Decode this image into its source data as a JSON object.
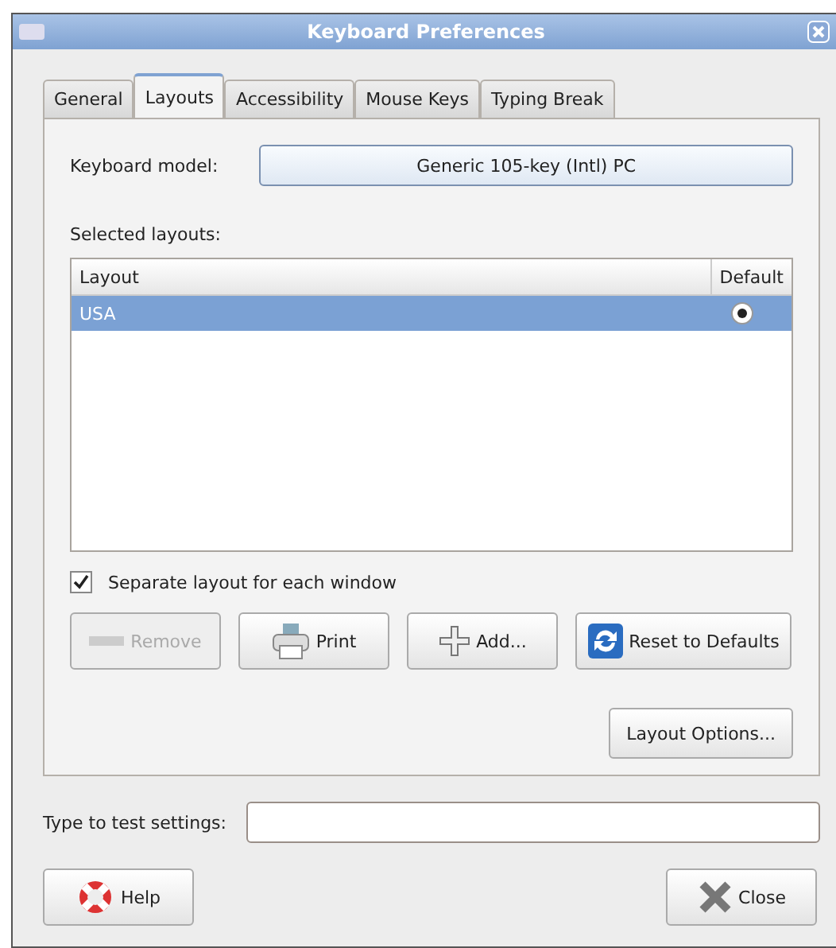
{
  "window": {
    "title": "Keyboard Preferences"
  },
  "tabs": [
    {
      "label": "General",
      "selected": false
    },
    {
      "label": "Layouts",
      "selected": true
    },
    {
      "label": "Accessibility",
      "selected": false
    },
    {
      "label": "Mouse Keys",
      "selected": false
    },
    {
      "label": "Typing Break",
      "selected": false
    }
  ],
  "keyboard_model": {
    "label": "Keyboard model:",
    "value": "Generic 105-key (Intl) PC"
  },
  "selected_layouts": {
    "label": "Selected layouts:",
    "columns": [
      "Layout",
      "Default"
    ],
    "rows": [
      {
        "layout": "USA",
        "selected": true,
        "default": true
      }
    ]
  },
  "separate_layout": {
    "label": "Separate layout for each window",
    "checked": true
  },
  "buttons": [
    {
      "kind": "remove",
      "label": "Remove",
      "disabled": true
    },
    {
      "kind": "print",
      "label": "Print",
      "disabled": false
    },
    {
      "kind": "add",
      "label": "Add...",
      "disabled": false
    },
    {
      "kind": "reset",
      "label": "Reset to Defaults",
      "disabled": false
    }
  ],
  "layout_options": {
    "label": "Layout Options..."
  },
  "test": {
    "label": "Type to test settings:"
  },
  "footer": [
    {
      "kind": "help",
      "label": "Help"
    },
    {
      "kind": "close",
      "label": "Close"
    }
  ]
}
